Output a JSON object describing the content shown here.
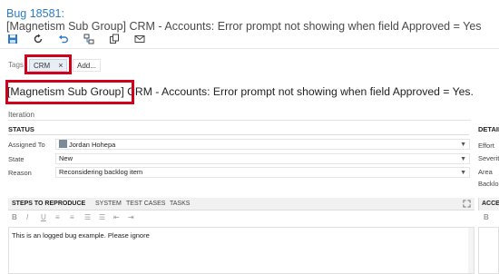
{
  "header": {
    "bug_id": "Bug 18581:",
    "bug_title": "[Magnetism Sub Group] CRM - Accounts: Error prompt not showing when field Approved = Yes"
  },
  "toolbar": {
    "buttons": [
      {
        "name": "save-icon"
      },
      {
        "name": "refresh-icon"
      },
      {
        "name": "undo-icon"
      },
      {
        "name": "link-icon"
      },
      {
        "name": "copy-icon"
      },
      {
        "name": "email-icon"
      }
    ]
  },
  "tags": {
    "label": "Tags",
    "items": [
      "CRM"
    ],
    "remove_glyph": "×",
    "add_label": "Add..."
  },
  "title_field": {
    "prefix": "[Magnetism Sub Group]",
    "rest": " CRM - Accounts: Error prompt not showing when field Approved = Yes."
  },
  "iteration": {
    "label": "Iteration"
  },
  "status": {
    "header": "STATUS",
    "fields": [
      {
        "label": "Assigned To",
        "value": "Jordan Hohepa"
      },
      {
        "label": "State",
        "value": "New"
      },
      {
        "label": "Reason",
        "value": "Reconsidering backlog item"
      }
    ]
  },
  "details": {
    "header": "DETAIL",
    "labels": [
      "Effort",
      "Severit",
      "Area",
      "Backlo"
    ]
  },
  "steps": {
    "tabs": [
      "STEPS TO REPRODUCE",
      "SYSTEM",
      "TEST CASES",
      "TASKS"
    ],
    "format_buttons": [
      "B",
      "I",
      "U",
      "≡",
      "≡",
      "☰",
      "☰",
      "⇤",
      "⇥"
    ],
    "content": "This is an logged bug example. Please ignore"
  },
  "acceptance": {
    "tab_label": "ACCEP",
    "format_first": "B"
  },
  "colors": {
    "accent": "#2d7bc4",
    "highlight_box": "#d0021b",
    "tag_bg": "#e8eef5"
  }
}
